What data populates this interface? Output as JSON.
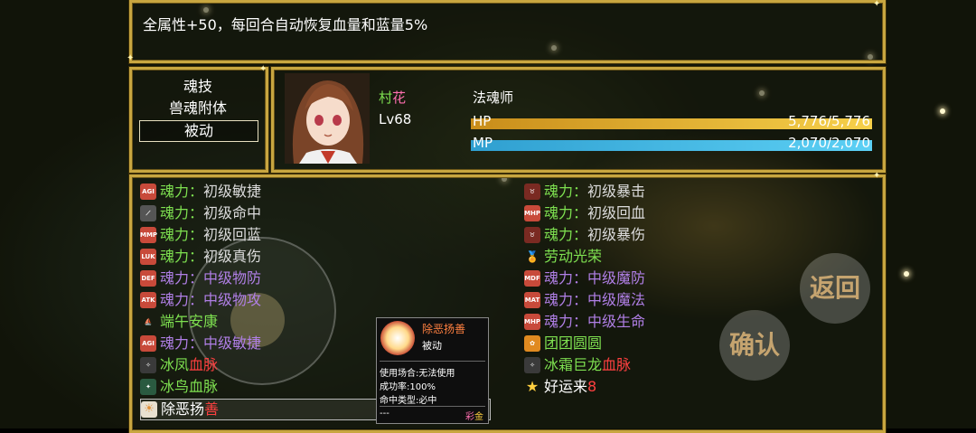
{
  "description": "全属性+50，每回合自动恢复血量和蓝量5%",
  "menu": {
    "items": [
      "魂技",
      "兽魂附体",
      "被动"
    ],
    "selected_index": 2
  },
  "character": {
    "name_part1": "村",
    "name_part2": "花",
    "level": "Lv68",
    "job": "法魂师",
    "hp_label": "HP",
    "hp_value": "5,776/5,776",
    "hp_fraction": 1.0,
    "mp_label": "MP",
    "mp_value": "2,070/2,070",
    "mp_fraction": 1.0
  },
  "left_skills": [
    {
      "prefix": "魂力",
      "colon": "：",
      "level": "初级",
      "name": "敏捷",
      "icon": "AGI"
    },
    {
      "prefix": "魂力",
      "colon": "：",
      "level": "初级",
      "name": "命中",
      "icon": "claw"
    },
    {
      "prefix": "魂力",
      "colon": "：",
      "level": "初级",
      "name": "回蓝",
      "icon": "MMP"
    },
    {
      "prefix": "魂力",
      "colon": "：",
      "level": "初级",
      "name": "真伤",
      "icon": "LUK"
    },
    {
      "prefix": "魂力",
      "colon": "：",
      "level": "中级",
      "name": "物防",
      "icon": "DEF"
    },
    {
      "prefix": "魂力",
      "colon": "：",
      "level": "中级",
      "name": "物攻",
      "icon": "ATK"
    },
    {
      "plain_a": "端午安康",
      "icon": "dragon-boat"
    },
    {
      "prefix": "魂力",
      "colon": "：",
      "level": "中级",
      "name": "敏捷",
      "icon": "AGI"
    },
    {
      "plain_a": "冰凤",
      "plain_b": "血脉",
      "icon": "phoenix"
    },
    {
      "plain_a": "冰鸟血脉",
      "icon": "bird"
    },
    {
      "plain_a": "除恶扬",
      "plain_b": "善",
      "icon": "sun"
    }
  ],
  "right_skills": [
    {
      "prefix": "魂力",
      "colon": "：",
      "level": "初级",
      "name": "暴击",
      "icon": "bull"
    },
    {
      "prefix": "魂力",
      "colon": "：",
      "level": "初级",
      "name": "回血",
      "icon": "MHP"
    },
    {
      "prefix": "魂力",
      "colon": "：",
      "level": "初级",
      "name": "暴伤",
      "icon": "bull"
    },
    {
      "plain_a": "劳动光荣",
      "icon": "medal"
    },
    {
      "prefix": "魂力",
      "colon": "：",
      "level": "中级",
      "name": "魔防",
      "icon": "MDF"
    },
    {
      "prefix": "魂力",
      "colon": "：",
      "level": "中级",
      "name": "魔法",
      "icon": "MAT"
    },
    {
      "prefix": "魂力",
      "colon": "：",
      "level": "中级",
      "name": "生命",
      "icon": "MHP"
    },
    {
      "plain_a": "团团圆圆",
      "icon": "flower"
    },
    {
      "plain_a": "冰霜",
      "plain_b": "巨龙",
      "plain_c": "血脉",
      "icon": "phoenix"
    },
    {
      "plain_a": "好运来",
      "plain_b": "8",
      "icon": "star"
    }
  ],
  "buttons": {
    "back": "返回",
    "confirm": "确认"
  },
  "tooltip": {
    "name": "除恶扬善",
    "type": "被动",
    "usage": "使用场合:无法使用",
    "success": "成功率:100%",
    "hit_type": "命中类型:必中",
    "footer_left": "---",
    "rarity_a": "彩",
    "rarity_b": "金"
  },
  "colors": {
    "frame": "#c8a640",
    "hp_bar": "#f2c23a",
    "mp_bar": "#41b8e8",
    "soul_green": "#7ee050",
    "mid_purple": "#b07fe6",
    "white": "#ffffff",
    "red": "#ff4040"
  }
}
